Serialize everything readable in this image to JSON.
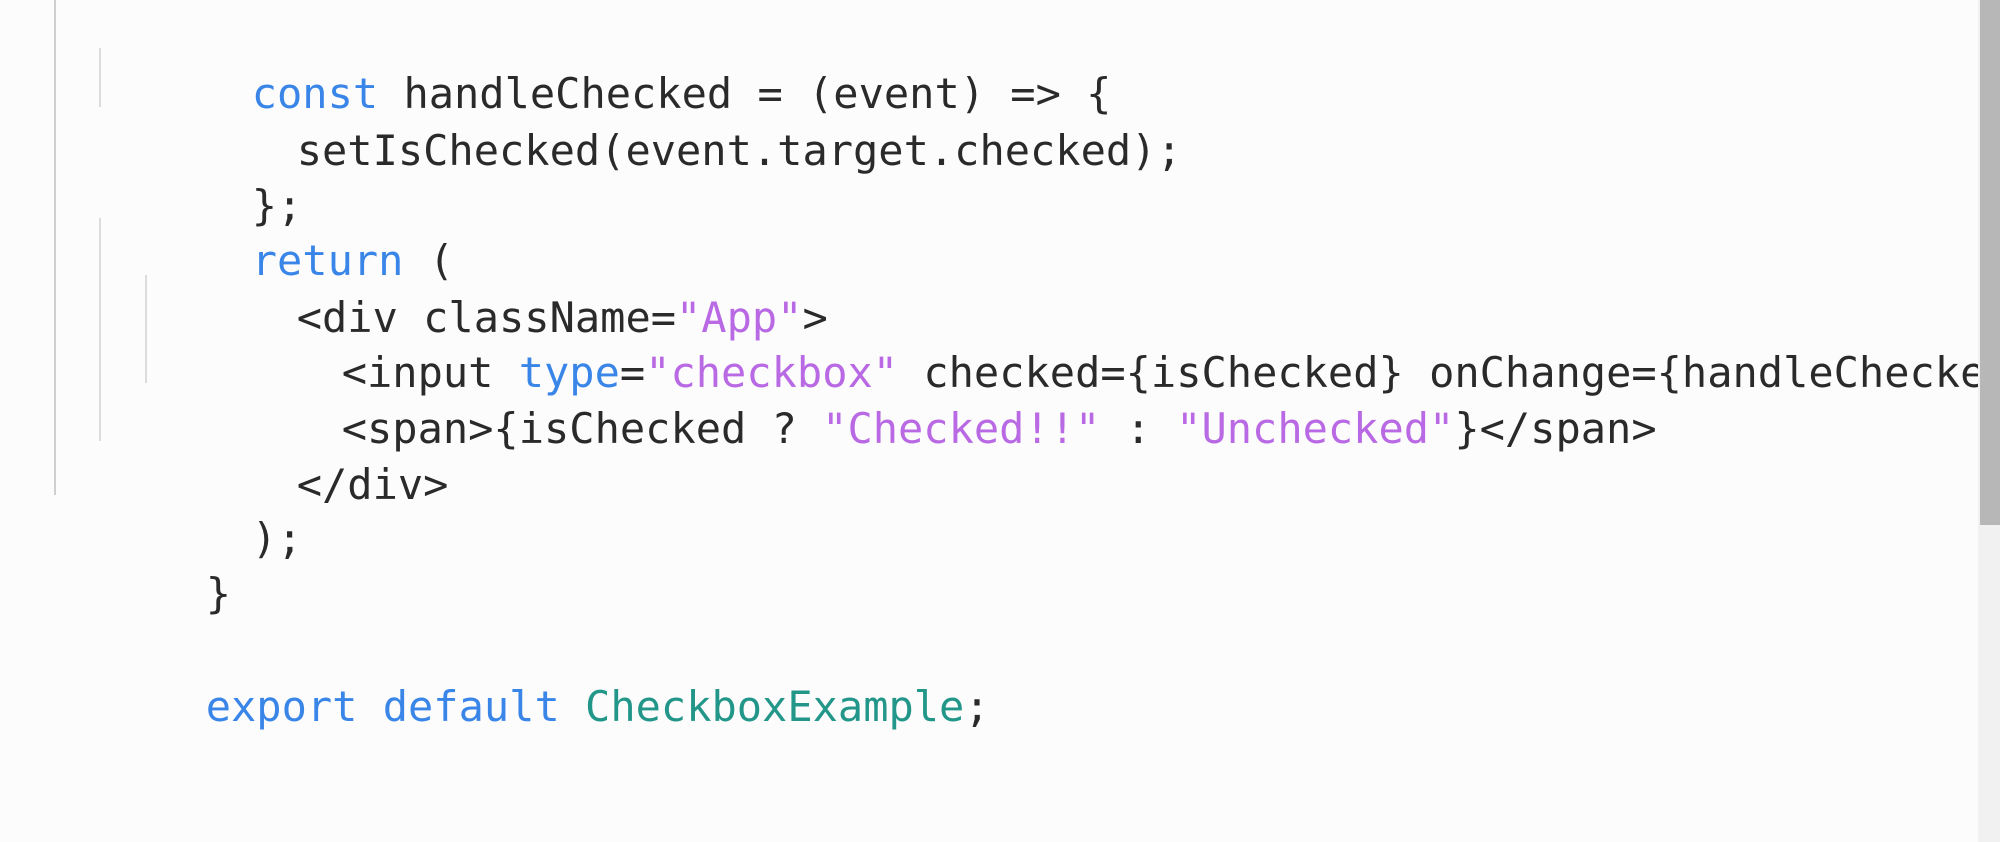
{
  "code": {
    "l1": {
      "kw": "const",
      "rest": " handleChecked = (event) => {"
    },
    "l2": {
      "text": "setIsChecked(event.target.checked);"
    },
    "l3": {
      "text": "};"
    },
    "l4": {
      "kw": "return",
      "rest": " ("
    },
    "l5": {
      "a": "<div className=",
      "str": "\"App\"",
      "b": ">"
    },
    "l6": {
      "a": "<input ",
      "kw": "type",
      "b": "=",
      "str1": "\"checkbox\"",
      "c": " checked={isChecked} onChange={handleChecked} />"
    },
    "l7": {
      "a": "<span>{isChecked ? ",
      "str1": "\"Checked!!\"",
      "b": " : ",
      "str2": "\"Unchecked\"",
      "c": "}</span>"
    },
    "l8": {
      "text": "</div>"
    },
    "l9": {
      "text": ");"
    },
    "l10": {
      "text": "}"
    },
    "l11": {
      "kw1": "export",
      "sp1": " ",
      "kw2": "default",
      "sp2": " ",
      "cls": "CheckboxExample",
      "c": ";"
    }
  },
  "colors": {
    "keyword": "#3a86e8",
    "string": "#b869e3",
    "class_name": "#23968a",
    "plain_text": "#2a2a2a",
    "background": "#fcfcfc"
  }
}
